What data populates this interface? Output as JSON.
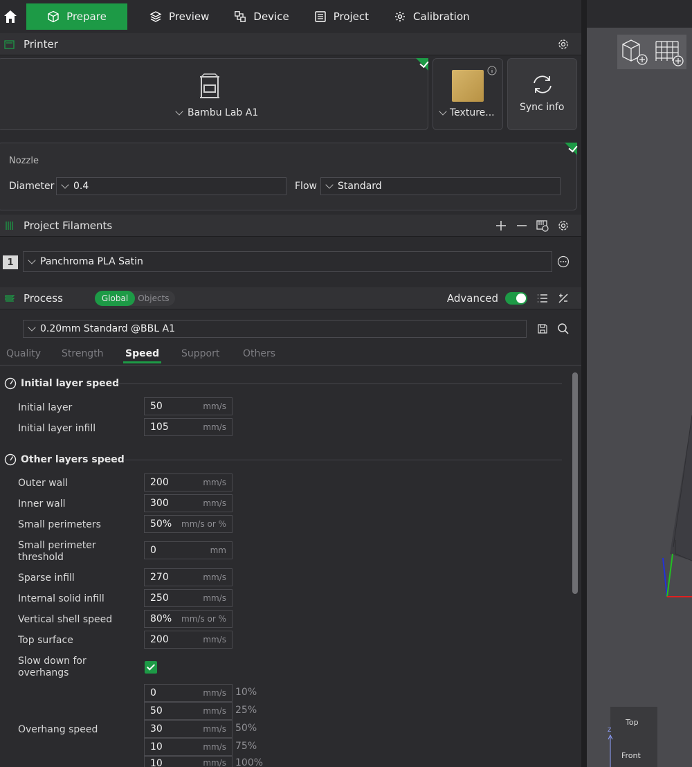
{
  "nav": {
    "tabs": [
      {
        "label": "Prepare",
        "icon": "cube-icon"
      },
      {
        "label": "Preview",
        "icon": "layers-icon"
      },
      {
        "label": "Device",
        "icon": "device-icon"
      },
      {
        "label": "Project",
        "icon": "project-icon"
      },
      {
        "label": "Calibration",
        "icon": "gear-icon"
      }
    ]
  },
  "printer": {
    "section_title": "Printer",
    "name": "Bambu Lab A1",
    "plate": "Texture...",
    "sync_label": "Sync info"
  },
  "nozzle": {
    "title": "Nozzle",
    "diameter_label": "Diameter",
    "diameter_value": "0.4",
    "flow_label": "Flow",
    "flow_value": "Standard"
  },
  "filaments": {
    "section_title": "Project Filaments",
    "items": [
      {
        "index": "1",
        "name": "Panchroma PLA Satin"
      }
    ]
  },
  "process": {
    "section_title": "Process",
    "global_label": "Global",
    "objects_label": "Objects",
    "advanced_label": "Advanced",
    "preset": "0.20mm Standard @BBL A1",
    "tabs": [
      "Quality",
      "Strength",
      "Speed",
      "Support",
      "Others"
    ],
    "active_tab": "Speed"
  },
  "speed": {
    "initial_group": "Initial layer speed",
    "other_group": "Other layers speed",
    "rows": [
      {
        "label": "Initial layer",
        "value": "50",
        "unit": "mm/s"
      },
      {
        "label": "Initial layer infill",
        "value": "105",
        "unit": "mm/s"
      },
      {
        "label": "Outer wall",
        "value": "200",
        "unit": "mm/s"
      },
      {
        "label": "Inner wall",
        "value": "300",
        "unit": "mm/s"
      },
      {
        "label": "Small perimeters",
        "value": "50%",
        "unit": "mm/s or %"
      },
      {
        "label": "Small perimeter threshold",
        "value": "0",
        "unit": "mm"
      },
      {
        "label": "Sparse infill",
        "value": "270",
        "unit": "mm/s"
      },
      {
        "label": "Internal solid infill",
        "value": "250",
        "unit": "mm/s"
      },
      {
        "label": "Vertical shell speed",
        "value": "80%",
        "unit": "mm/s or %"
      },
      {
        "label": "Top surface",
        "value": "200",
        "unit": "mm/s"
      }
    ],
    "slowdown_label": "Slow down for overhangs",
    "overhang_label": "Overhang speed",
    "overhang": [
      {
        "value": "0",
        "unit": "mm/s",
        "pct": "10%"
      },
      {
        "value": "50",
        "unit": "mm/s",
        "pct": "25%"
      },
      {
        "value": "30",
        "unit": "mm/s",
        "pct": "50%"
      },
      {
        "value": "10",
        "unit": "mm/s",
        "pct": "75%"
      },
      {
        "value": "10",
        "unit": "mm/s",
        "pct": "100%"
      }
    ]
  },
  "viewport": {
    "top_label": "Top",
    "front_label": "Front",
    "axis_z": "Z"
  }
}
